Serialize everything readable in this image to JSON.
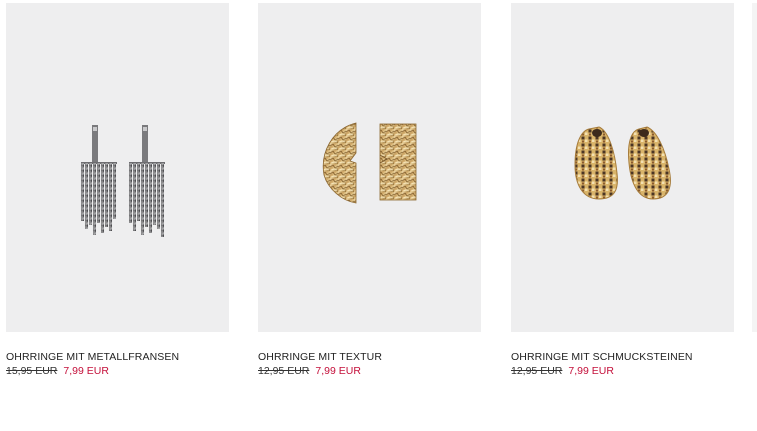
{
  "products": [
    {
      "name": "OHRRINGE MIT METALLFRANSEN",
      "old_price": "15,95 EUR",
      "new_price": "7,99 EUR",
      "image": "silver-fringe-earrings"
    },
    {
      "name": "OHRRINGE MIT TEXTUR",
      "old_price": "12,95 EUR",
      "new_price": "7,99 EUR",
      "image": "gold-textured-earrings"
    },
    {
      "name": "OHRRINGE MIT SCHMUCKSTEINEN",
      "old_price": "12,95 EUR",
      "new_price": "7,99 EUR",
      "image": "gold-jewel-stone-earrings"
    }
  ],
  "colors": {
    "image_background": "#eeeeef",
    "sale_price": "#c40f3a",
    "text": "#222222"
  }
}
